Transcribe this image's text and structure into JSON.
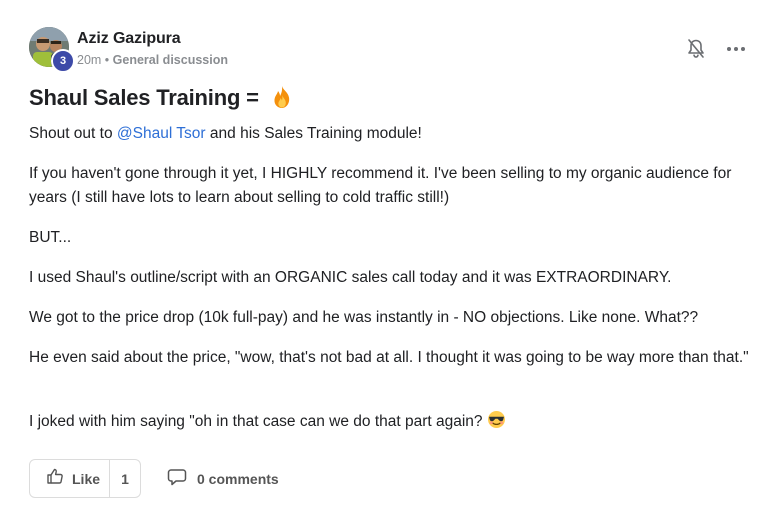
{
  "post": {
    "author": {
      "name": "Aziz Gazipura",
      "level": "3",
      "avatar_icon": "user-photo-avatar"
    },
    "timestamp": "20m",
    "separator": " • ",
    "category": "General discussion",
    "title": "Shaul Sales Training = ",
    "title_emoji": "fire-emoji",
    "body": {
      "p1_prefix": "Shout out to ",
      "p1_mention": "@Shaul Tsor",
      "p1_suffix": " and his Sales Training module!",
      "p2": "If you haven't gone through it yet, I HIGHLY recommend it. I've been selling to my organic audience for years (I still have lots to learn about selling to cold traffic still!)",
      "p3": "BUT...",
      "p4": "I used Shaul's outline/script with an ORGANIC sales call today and it was EXTRAORDINARY.",
      "p5": "We got to the price drop (10k full-pay) and he was instantly in - NO objections. Like none. What??",
      "p6": "He even said about the price, \"wow, that's not bad at all. I thought it was going to be way more than that.\"",
      "p7": "I joked with him saying \"oh in that case can we do that part again?",
      "p7_emoji": "sunglasses-emoji"
    },
    "actions": {
      "like_label": "Like",
      "like_count": "1",
      "comments_label": "0 comments"
    }
  },
  "colors": {
    "mention": "#2e6fd6",
    "badge": "#3d4aa8",
    "muted": "#8a8d91"
  }
}
